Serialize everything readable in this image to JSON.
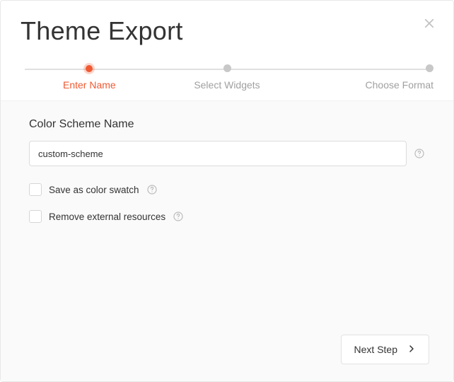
{
  "modal": {
    "title": "Theme Export"
  },
  "stepper": {
    "steps": [
      {
        "label": "Enter Name",
        "active": true
      },
      {
        "label": "Select Widgets",
        "active": false
      },
      {
        "label": "Choose Format",
        "active": false
      }
    ]
  },
  "form": {
    "scheme_name_label": "Color Scheme Name",
    "scheme_name_value": "custom-scheme",
    "save_swatch_label": "Save as color swatch",
    "remove_external_label": "Remove external resources"
  },
  "footer": {
    "next_label": "Next Step"
  }
}
